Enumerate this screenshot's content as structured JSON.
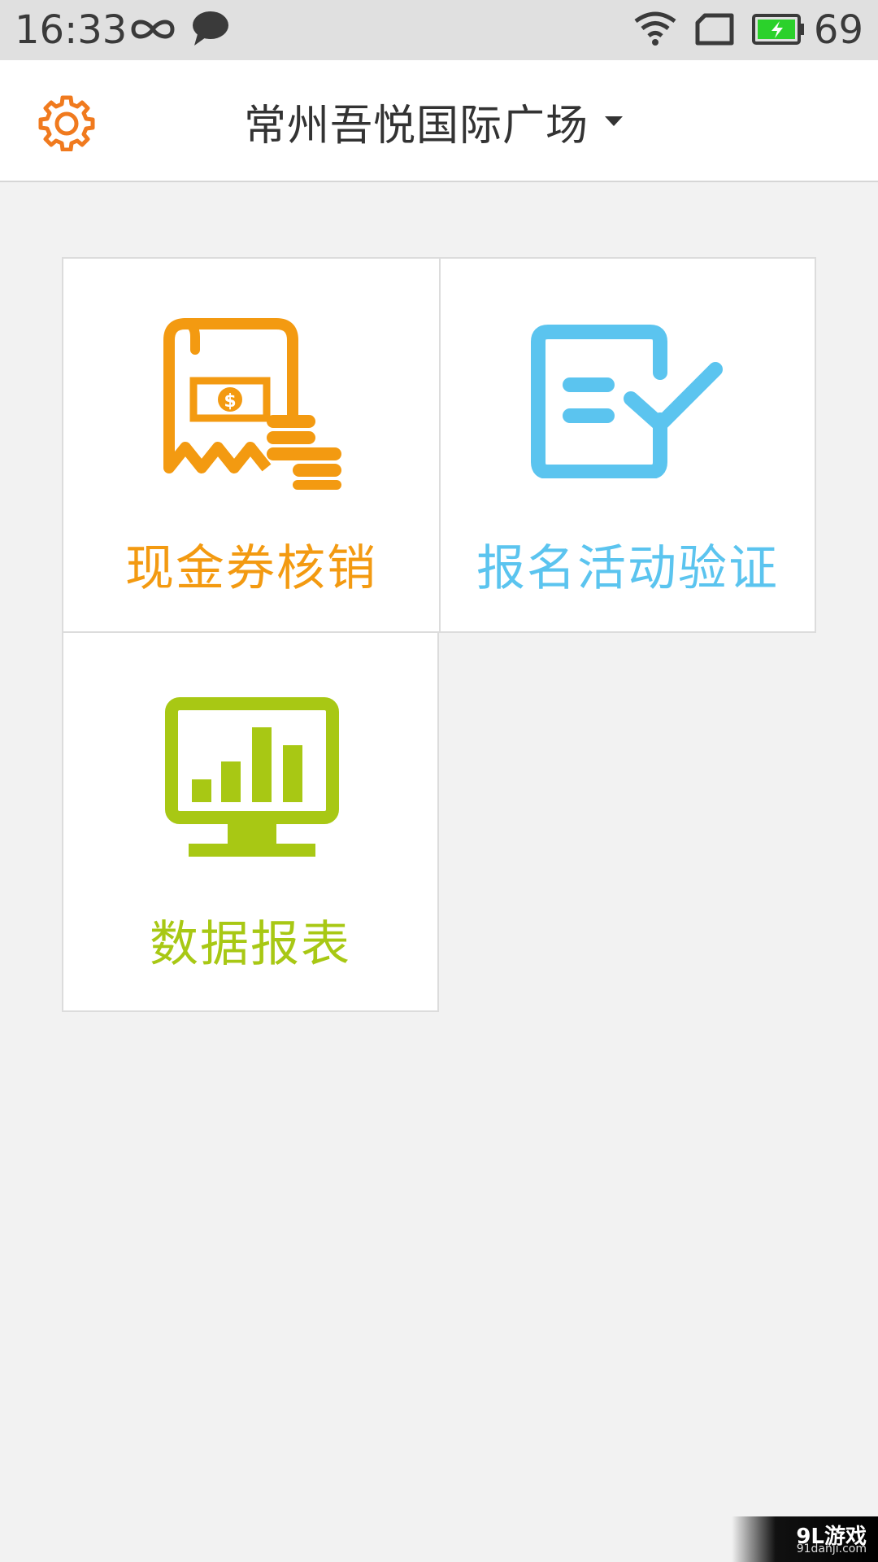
{
  "status_bar": {
    "time": "16:33",
    "battery_percent": "69",
    "icons": [
      "infinity-icon",
      "chat-bubble-icon",
      "wifi-icon",
      "sim-card-icon",
      "battery-charging-icon"
    ],
    "battery_color": "#2bd12b"
  },
  "header": {
    "title": "常州吾悦国际广场",
    "settings_icon": "gear-icon",
    "dropdown_icon": "caret-down-icon",
    "accent_color": "#f07a1e"
  },
  "tiles": [
    {
      "label": "现金券核销",
      "icon": "cash-voucher-icon",
      "color": "#f39a11"
    },
    {
      "label": "报名活动验证",
      "icon": "checklist-icon",
      "color": "#5bc4ef"
    },
    {
      "label": "数据报表",
      "icon": "monitor-chart-icon",
      "color": "#a8c814"
    }
  ],
  "watermark": {
    "main": "9L游戏",
    "sub": "91danji.com"
  }
}
